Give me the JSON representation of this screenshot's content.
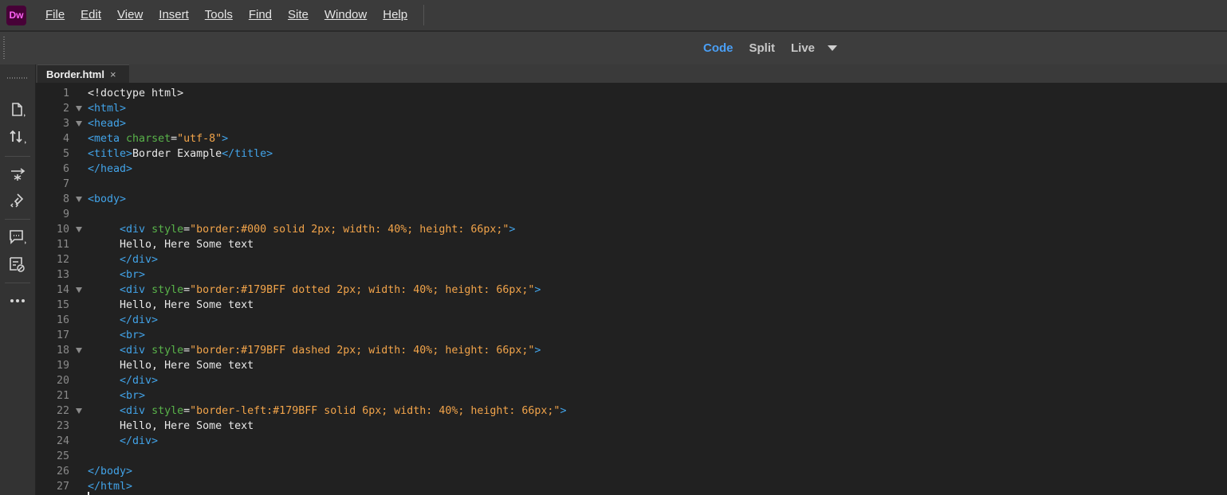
{
  "app": {
    "logo_text": "Dw",
    "logo_bg": "#470137",
    "logo_fg": "#ff61f6"
  },
  "menu": [
    "File",
    "Edit",
    "View",
    "Insert",
    "Tools",
    "Find",
    "Site",
    "Window",
    "Help"
  ],
  "view_tabs": {
    "code": "Code",
    "split": "Split",
    "live": "Live",
    "active": "Code"
  },
  "left_tools": [
    "files-icon",
    "sort-arrows-icon",
    "dom-tree-icon",
    "css-designer-icon",
    "comment-icon",
    "code-hint-icon",
    "more-icon"
  ],
  "document_tab": {
    "label": "Border.html",
    "close": "×"
  },
  "colors": {
    "tag": "#42a3e8",
    "attr": "#59b34a",
    "string": "#f2a44a",
    "text": "#e8e8e8",
    "line_number": "#8a8a8a",
    "accent": "#4a9ff5"
  },
  "code_lines": [
    {
      "n": "1",
      "fold": false,
      "indent": "",
      "tokens": [
        {
          "k": "doc",
          "t": "<!doctype html>"
        }
      ]
    },
    {
      "n": "2",
      "fold": true,
      "indent": "",
      "tokens": [
        {
          "k": "tag",
          "t": "<html>"
        }
      ]
    },
    {
      "n": "3",
      "fold": true,
      "indent": "",
      "tokens": [
        {
          "k": "tag",
          "t": "<head>"
        }
      ]
    },
    {
      "n": "4",
      "fold": false,
      "indent": "",
      "tokens": [
        {
          "k": "tag",
          "t": "<meta "
        },
        {
          "k": "attr",
          "t": "charset"
        },
        {
          "k": "txt",
          "t": "="
        },
        {
          "k": "str",
          "t": "\"utf-8\""
        },
        {
          "k": "tag",
          "t": ">"
        }
      ]
    },
    {
      "n": "5",
      "fold": false,
      "indent": "",
      "tokens": [
        {
          "k": "tag",
          "t": "<title>"
        },
        {
          "k": "txt",
          "t": "Border Example"
        },
        {
          "k": "tag",
          "t": "</title>"
        }
      ]
    },
    {
      "n": "6",
      "fold": false,
      "indent": "",
      "tokens": [
        {
          "k": "tag",
          "t": "</head>"
        }
      ]
    },
    {
      "n": "7",
      "fold": false,
      "indent": "",
      "tokens": []
    },
    {
      "n": "8",
      "fold": true,
      "indent": "",
      "tokens": [
        {
          "k": "tag",
          "t": "<body>"
        }
      ]
    },
    {
      "n": "9",
      "fold": false,
      "indent": "",
      "tokens": []
    },
    {
      "n": "10",
      "fold": true,
      "indent": "     ",
      "tokens": [
        {
          "k": "tag",
          "t": "<div "
        },
        {
          "k": "attr",
          "t": "style"
        },
        {
          "k": "txt",
          "t": "="
        },
        {
          "k": "str",
          "t": "\"border:#000 solid 2px; width: 40%; height: 66px;\""
        },
        {
          "k": "tag",
          "t": ">"
        }
      ]
    },
    {
      "n": "11",
      "fold": false,
      "indent": "     ",
      "tokens": [
        {
          "k": "txt",
          "t": "Hello, Here Some text"
        }
      ]
    },
    {
      "n": "12",
      "fold": false,
      "indent": "     ",
      "tokens": [
        {
          "k": "tag",
          "t": "</div>"
        }
      ]
    },
    {
      "n": "13",
      "fold": false,
      "indent": "     ",
      "tokens": [
        {
          "k": "tag",
          "t": "<br>"
        }
      ]
    },
    {
      "n": "14",
      "fold": true,
      "indent": "     ",
      "tokens": [
        {
          "k": "tag",
          "t": "<div "
        },
        {
          "k": "attr",
          "t": "style"
        },
        {
          "k": "txt",
          "t": "="
        },
        {
          "k": "str",
          "t": "\"border:#179BFF dotted 2px; width: 40%; height: 66px;\""
        },
        {
          "k": "tag",
          "t": ">"
        }
      ]
    },
    {
      "n": "15",
      "fold": false,
      "indent": "     ",
      "tokens": [
        {
          "k": "txt",
          "t": "Hello, Here Some text"
        }
      ]
    },
    {
      "n": "16",
      "fold": false,
      "indent": "     ",
      "tokens": [
        {
          "k": "tag",
          "t": "</div>"
        }
      ]
    },
    {
      "n": "17",
      "fold": false,
      "indent": "     ",
      "tokens": [
        {
          "k": "tag",
          "t": "<br>"
        }
      ]
    },
    {
      "n": "18",
      "fold": true,
      "indent": "     ",
      "tokens": [
        {
          "k": "tag",
          "t": "<div "
        },
        {
          "k": "attr",
          "t": "style"
        },
        {
          "k": "txt",
          "t": "="
        },
        {
          "k": "str",
          "t": "\"border:#179BFF dashed 2px; width: 40%; height: 66px;\""
        },
        {
          "k": "tag",
          "t": ">"
        }
      ]
    },
    {
      "n": "19",
      "fold": false,
      "indent": "     ",
      "tokens": [
        {
          "k": "txt",
          "t": "Hello, Here Some text"
        }
      ]
    },
    {
      "n": "20",
      "fold": false,
      "indent": "     ",
      "tokens": [
        {
          "k": "tag",
          "t": "</div>"
        }
      ]
    },
    {
      "n": "21",
      "fold": false,
      "indent": "     ",
      "tokens": [
        {
          "k": "tag",
          "t": "<br>"
        }
      ]
    },
    {
      "n": "22",
      "fold": true,
      "indent": "     ",
      "tokens": [
        {
          "k": "tag",
          "t": "<div "
        },
        {
          "k": "attr",
          "t": "style"
        },
        {
          "k": "txt",
          "t": "="
        },
        {
          "k": "str",
          "t": "\"border-left:#179BFF solid 6px; width: 40%; height: 66px;\""
        },
        {
          "k": "tag",
          "t": ">"
        }
      ]
    },
    {
      "n": "23",
      "fold": false,
      "indent": "     ",
      "tokens": [
        {
          "k": "txt",
          "t": "Hello, Here Some text"
        }
      ]
    },
    {
      "n": "24",
      "fold": false,
      "indent": "     ",
      "tokens": [
        {
          "k": "tag",
          "t": "</div>"
        }
      ]
    },
    {
      "n": "25",
      "fold": false,
      "indent": "",
      "tokens": []
    },
    {
      "n": "26",
      "fold": false,
      "indent": "",
      "tokens": [
        {
          "k": "tag",
          "t": "</body>"
        }
      ]
    },
    {
      "n": "27",
      "fold": false,
      "indent": "",
      "tokens": [
        {
          "k": "tag",
          "t": "</html>"
        }
      ]
    }
  ]
}
